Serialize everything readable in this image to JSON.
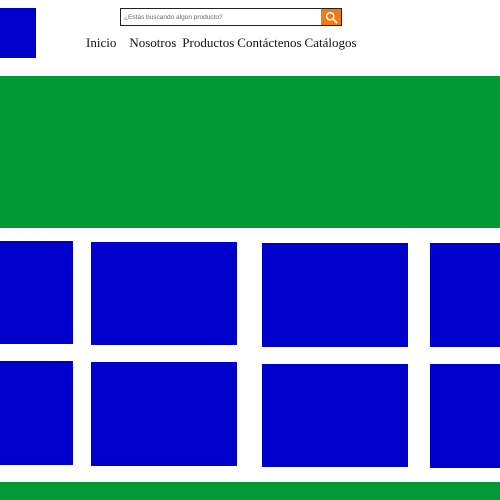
{
  "search": {
    "placeholder": "¿Estás buscando algún producto?",
    "button_icon": "search-icon",
    "button_color": "#f07b12"
  },
  "nav": {
    "items": [
      "Inicio",
      "Nosotros",
      "Productos",
      "Contáctenos",
      "Catálogos"
    ]
  },
  "colors": {
    "brand_blue": "#0000cc",
    "brand_green": "#009933",
    "accent_orange": "#f07b12"
  },
  "product_tiles": [
    {
      "row": 1,
      "position": 1,
      "icon": "product-image-placeholder"
    },
    {
      "row": 1,
      "position": 2,
      "icon": "product-image-placeholder"
    },
    {
      "row": 1,
      "position": 3,
      "icon": "product-image-placeholder"
    },
    {
      "row": 1,
      "position": 4,
      "icon": "product-image-placeholder"
    },
    {
      "row": 2,
      "position": 1,
      "icon": "product-image-placeholder"
    },
    {
      "row": 2,
      "position": 2,
      "icon": "product-image-placeholder"
    },
    {
      "row": 2,
      "position": 3,
      "icon": "product-image-placeholder"
    },
    {
      "row": 2,
      "position": 4,
      "icon": "product-image-placeholder"
    }
  ]
}
